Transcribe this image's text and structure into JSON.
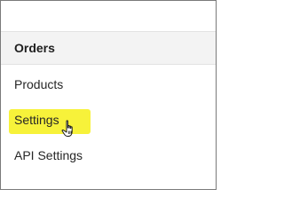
{
  "menu": {
    "header": "Orders",
    "items": [
      {
        "label": "Products"
      },
      {
        "label": "Settings"
      },
      {
        "label": "API Settings"
      }
    ]
  },
  "colors": {
    "highlight": "#f7f23a",
    "header_bg": "#f3f3f3",
    "frame_border": "#7a7a7a"
  },
  "icons": {
    "cursor": "hand-pointer-icon"
  }
}
